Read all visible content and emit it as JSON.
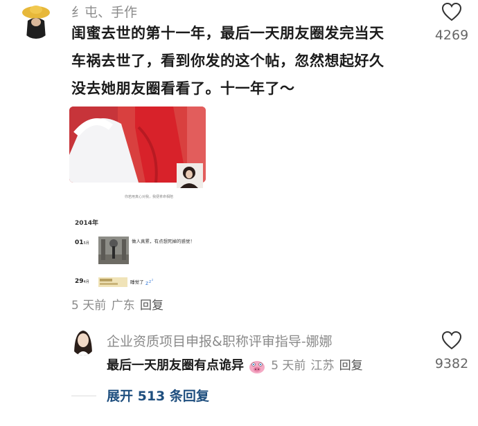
{
  "comment": {
    "author": "纟屯、手作",
    "text_lines": [
      "闺蜜去世的第十一年，最后一天朋友圈发完当天",
      "车祸去世了，看到你发的这个帖，忽然想起好久",
      "没去她朋友圈看看了。十一年了～"
    ],
    "like_count": "4269",
    "meta": {
      "time": "5 天前",
      "location": "广东",
      "reply": "回复"
    },
    "screenshot": {
      "watermark": "你若用真心对我，我便拿命相陪",
      "year": "2014年",
      "entry1": {
        "day": "01",
        "month": "5月",
        "text": "做人真累，有点想死掉的感觉！"
      },
      "entry2": {
        "day": "29",
        "month": "4月",
        "text": "睡觉了"
      }
    }
  },
  "reply": {
    "author": "企业资质项目申报&职称评审指导-娜娜",
    "text": "最后一天朋友圈有点诡异",
    "meta": {
      "time": "5 天前",
      "location": "江苏",
      "reply": "回复"
    },
    "like_count": "9382"
  },
  "expand_label": "展开 513 条回复",
  "colors": {
    "accent_link": "#1f4f7f",
    "muted": "#8a8a8a",
    "dress_red": "#d8222a"
  }
}
